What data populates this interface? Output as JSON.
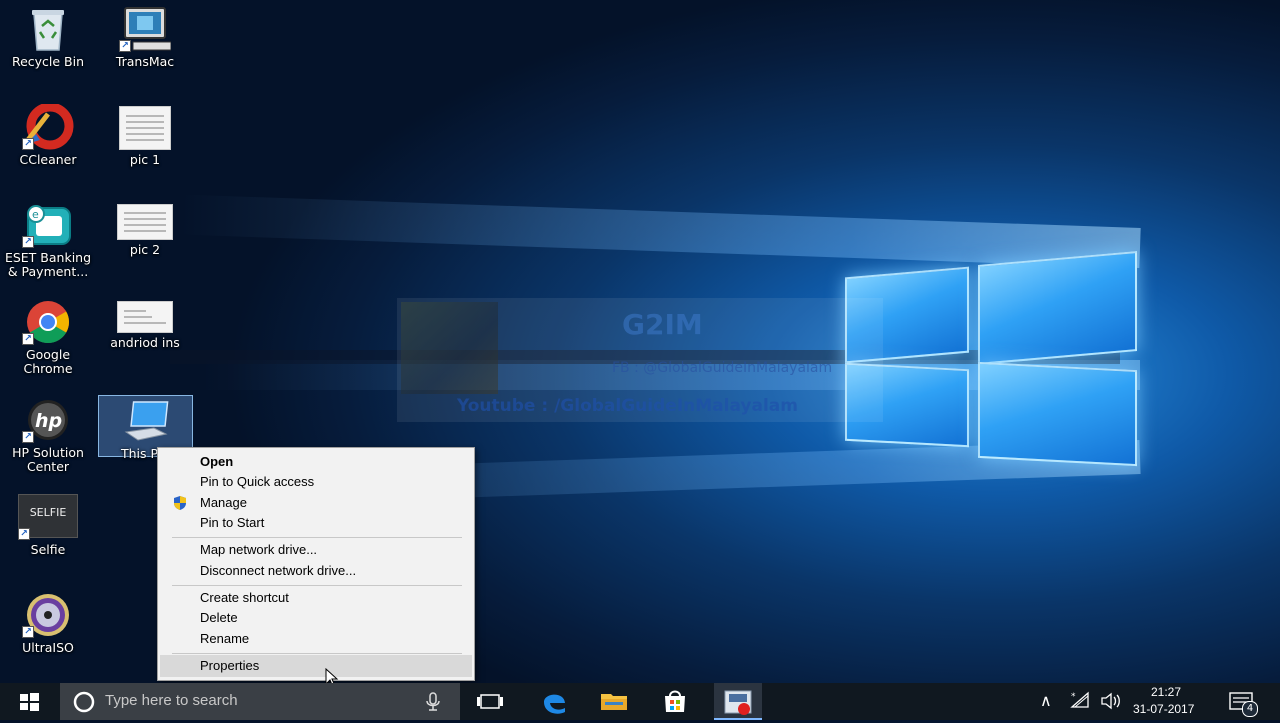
{
  "desktop": {
    "icons": [
      {
        "label": "Recycle Bin"
      },
      {
        "label": "TransMac"
      },
      {
        "label": "CCleaner"
      },
      {
        "label": "pic 1"
      },
      {
        "label": "ESET Banking & Payment..."
      },
      {
        "label": "pic 2"
      },
      {
        "label": "Google Chrome"
      },
      {
        "label": "andriod ins"
      },
      {
        "label": "HP Solution Center"
      },
      {
        "label": "This PC"
      },
      {
        "label": "Selfie"
      },
      {
        "label": "UltraISO"
      }
    ],
    "hp_logo_text": "hp",
    "selfie_logo_text": "SELFIE",
    "this_pc_visible_label": "This P"
  },
  "watermark": {
    "title": "G2IM",
    "facebook": "FB : @GlobalGuideInMalayalam",
    "youtube": "Youtube : /GlobalGuideInMalayalam"
  },
  "context_menu": {
    "items": [
      {
        "label": "Open"
      },
      {
        "label": "Pin to Quick access"
      },
      {
        "label": "Manage"
      },
      {
        "label": "Pin to Start"
      },
      {
        "label": "Map network drive..."
      },
      {
        "label": "Disconnect network drive..."
      },
      {
        "label": "Create shortcut"
      },
      {
        "label": "Delete"
      },
      {
        "label": "Rename"
      },
      {
        "label": "Properties"
      }
    ]
  },
  "taskbar": {
    "search_placeholder": "Type here to search",
    "time": "21:27",
    "date": "31-07-2017",
    "notification_count": "4"
  },
  "colors": {
    "accent": "#2fa1f5",
    "menu_bg": "#f2f2f2",
    "taskbar_bg": "#101820"
  }
}
